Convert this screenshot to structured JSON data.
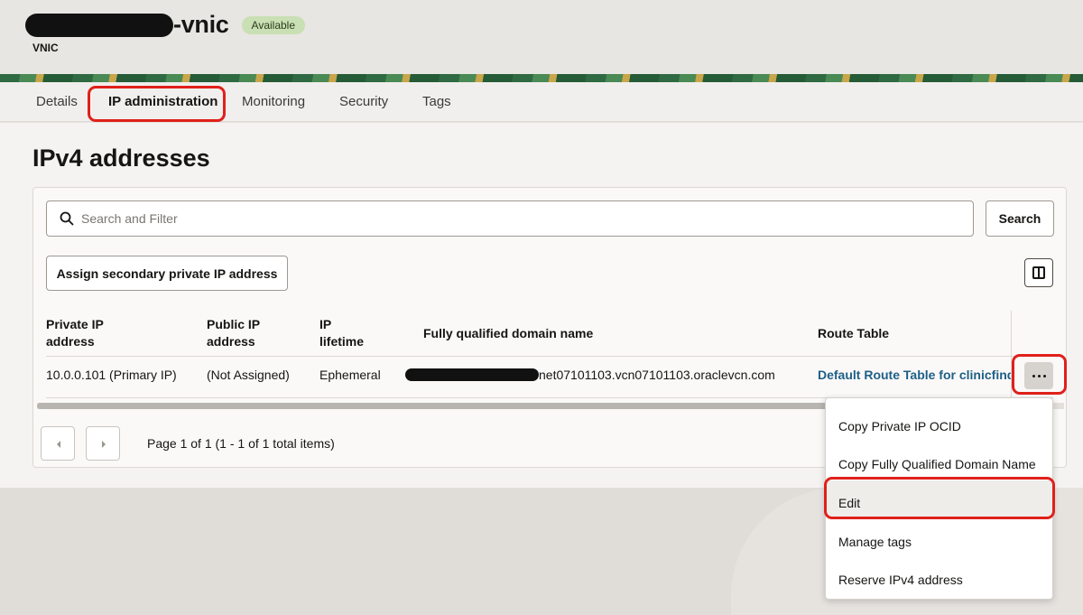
{
  "header": {
    "title_suffix": "-vnic",
    "status_badge": "Available",
    "subtitle": "VNIC"
  },
  "tabs": [
    {
      "label": "Details"
    },
    {
      "label": "IP administration"
    },
    {
      "label": "Monitoring"
    },
    {
      "label": "Security"
    },
    {
      "label": "Tags"
    }
  ],
  "page": {
    "title": "IPv4 addresses"
  },
  "toolbar": {
    "search_placeholder": "Search and Filter",
    "search_button": "Search",
    "assign_button": "Assign secondary private IP address",
    "columns_icon": "columns-icon"
  },
  "table": {
    "columns": [
      "Private IP\naddress",
      "Public IP\naddress",
      "IP\nlifetime",
      "Fully qualified domain name",
      "Route Table"
    ],
    "rows": [
      {
        "private_ip": "10.0.0.101 (Primary IP)",
        "public_ip": "(Not Assigned)",
        "lifetime": "Ephemeral",
        "fqdn_suffix": "net07101103.vcn07101103.oraclevcn.com",
        "route_table": "Default Route Table for clinicfind"
      }
    ]
  },
  "pagination": {
    "text": "Page 1 of 1 (1 - 1 of 1 total items)"
  },
  "context_menu": {
    "items": [
      {
        "label": "Copy Private IP OCID"
      },
      {
        "label": "Copy Fully Qualified Domain Name"
      },
      {
        "label": "Edit"
      },
      {
        "label": "Manage tags"
      },
      {
        "label": "Reserve IPv4 address"
      }
    ]
  },
  "colors": {
    "highlight": "#e0201b",
    "link": "#1e5f86",
    "badge_bg": "#c9dfb4"
  }
}
